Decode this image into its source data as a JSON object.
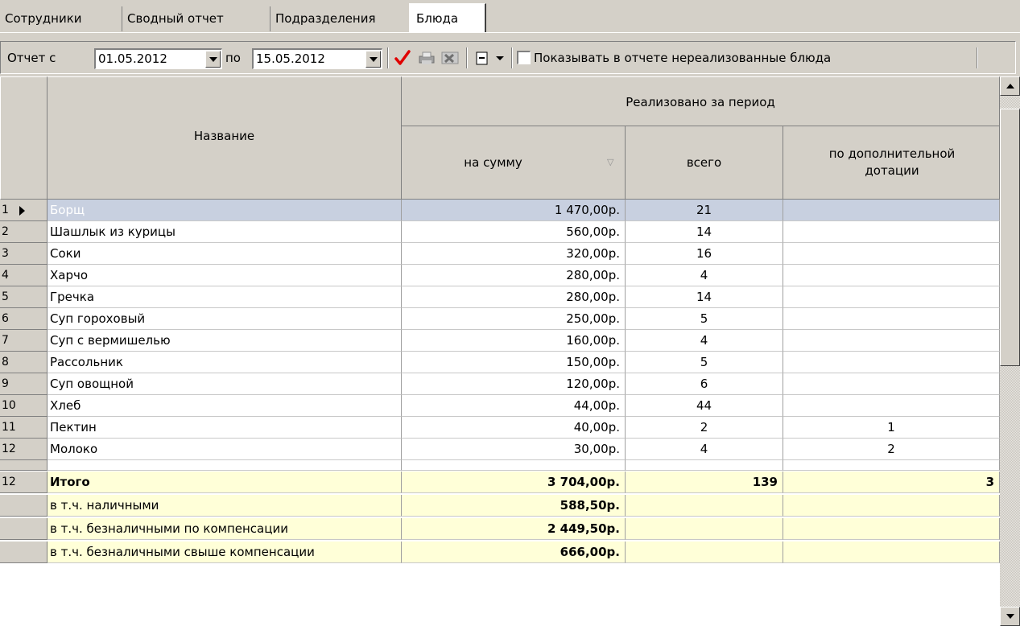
{
  "tabs": [
    "Сотрудники",
    "Сводный отчет",
    "Подразделения",
    "Блюда"
  ],
  "toolbar": {
    "from_label": "Отчет с",
    "date_from": "01.05.2012",
    "to_label": "по",
    "date_to": "15.05.2012",
    "checkbox_label": "Показывать в отчете нереализованные блюда",
    "checkbox_checked": false
  },
  "grid": {
    "headers": {
      "name": "Название",
      "group": "Реализовано за период",
      "sum": "на сумму",
      "total": "всего",
      "extra": "по дополнительной дотации"
    },
    "rows": [
      {
        "num": "1",
        "name": "Борщ",
        "sum": "1 470,00р.",
        "total": "21",
        "extra": ""
      },
      {
        "num": "2",
        "name": "Шашлык из курицы",
        "sum": "560,00р.",
        "total": "14",
        "extra": ""
      },
      {
        "num": "3",
        "name": "Соки",
        "sum": "320,00р.",
        "total": "16",
        "extra": ""
      },
      {
        "num": "4",
        "name": "Харчо",
        "sum": "280,00р.",
        "total": "4",
        "extra": ""
      },
      {
        "num": "5",
        "name": "Гречка",
        "sum": "280,00р.",
        "total": "14",
        "extra": ""
      },
      {
        "num": "6",
        "name": "Суп гороховый",
        "sum": "250,00р.",
        "total": "5",
        "extra": ""
      },
      {
        "num": "7",
        "name": "Суп с вермишелью",
        "sum": "160,00р.",
        "total": "4",
        "extra": ""
      },
      {
        "num": "8",
        "name": "Рассольник",
        "sum": "150,00р.",
        "total": "5",
        "extra": ""
      },
      {
        "num": "9",
        "name": "Суп овощной",
        "sum": "120,00р.",
        "total": "6",
        "extra": ""
      },
      {
        "num": "10",
        "name": "Хлеб",
        "sum": "44,00р.",
        "total": "44",
        "extra": ""
      },
      {
        "num": "11",
        "name": "Пектин",
        "sum": "40,00р.",
        "total": "2",
        "extra": "1"
      },
      {
        "num": "12",
        "name": "Молоко",
        "sum": "30,00р.",
        "total": "4",
        "extra": "2"
      }
    ],
    "footer": [
      {
        "num": "12",
        "name": "Итого",
        "sum": "3 704,00р.",
        "total": "139",
        "extra": "3"
      },
      {
        "num": "",
        "name": "в т.ч. наличными",
        "sum": "588,50р.",
        "total": "",
        "extra": ""
      },
      {
        "num": "",
        "name": "в т.ч. безналичными по компенсации",
        "sum": "2 449,50р.",
        "total": "",
        "extra": ""
      },
      {
        "num": "",
        "name": "в т.ч. безналичными свыше компенсации",
        "sum": "666,00р.",
        "total": "",
        "extra": ""
      }
    ]
  }
}
